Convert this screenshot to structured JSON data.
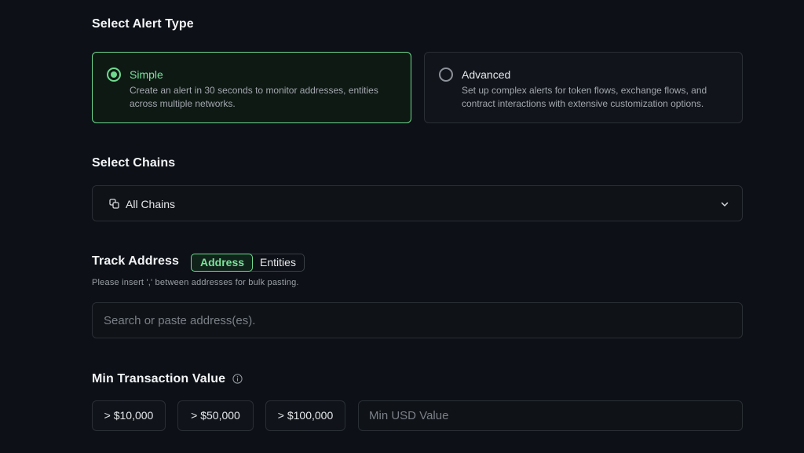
{
  "alert_type": {
    "title": "Select Alert Type",
    "options": [
      {
        "label": "Simple",
        "description": "Create an alert in 30 seconds to monitor addresses, entities across multiple networks.",
        "selected": true
      },
      {
        "label": "Advanced",
        "description": "Set up complex alerts for token flows, exchange flows, and contract interactions with extensive customization options.",
        "selected": false
      }
    ]
  },
  "chains": {
    "title": "Select Chains",
    "selected": "All Chains",
    "icon": "layers-icon"
  },
  "track": {
    "title": "Track Address",
    "tabs": [
      "Address",
      "Entities"
    ],
    "active_tab": "Address",
    "helper": "Please insert ',' between addresses for bulk pasting.",
    "placeholder": "Search or paste address(es)."
  },
  "min_value": {
    "title": "Min Transaction Value",
    "presets": [
      "> $10,000",
      "> $50,000",
      "> $100,000"
    ],
    "placeholder": "Min USD Value"
  },
  "colors": {
    "accent": "#6fd98f",
    "background": "#0d1016",
    "border": "#2a2e35"
  }
}
